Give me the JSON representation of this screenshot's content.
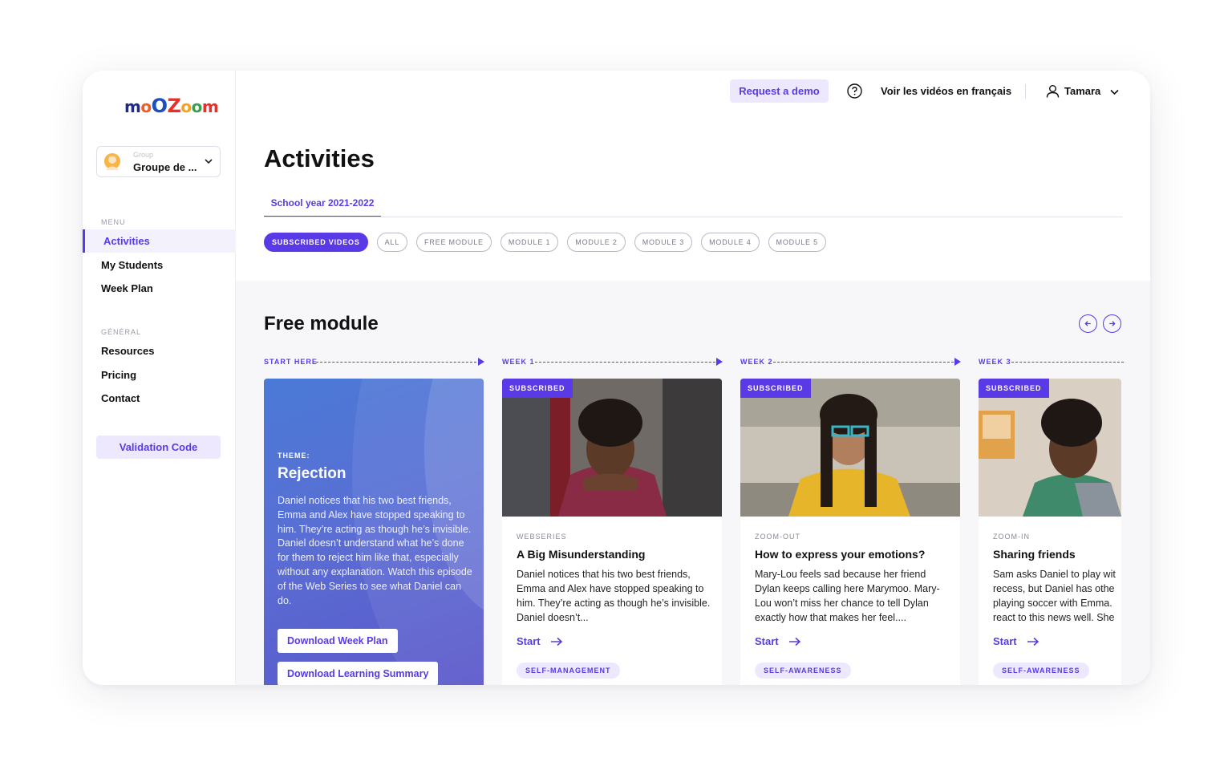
{
  "brand": {
    "logo_letters": [
      "m",
      "o",
      "O",
      "Z",
      "o",
      "o",
      "m"
    ],
    "logo_colors": [
      "#1e2a8c",
      "#f15a24",
      "#1e4fbf",
      "#e8302a",
      "#f7a21b",
      "#3aa04b",
      "#e8302a"
    ]
  },
  "sidebar": {
    "group": {
      "label": "Group",
      "name": "Groupe de ..."
    },
    "menu_label": "MENU",
    "menu_items": [
      {
        "label": "Activities",
        "active": true
      },
      {
        "label": "My Students",
        "active": false
      },
      {
        "label": "Week Plan",
        "active": false
      }
    ],
    "general_label": "GÉNÉRAL",
    "general_items": [
      {
        "label": "Resources"
      },
      {
        "label": "Pricing"
      },
      {
        "label": "Contact"
      }
    ],
    "validation_label": "Validation Code"
  },
  "topbar": {
    "demo_label": "Request a demo",
    "lang_label": "Voir les vidéos en français",
    "user_name": "Tamara"
  },
  "page": {
    "title": "Activities",
    "year_tab": "School year 2021-2022",
    "filters": [
      "SUBSCRIBED VIDEOS",
      "ALL",
      "FREE MODULE",
      "MODULE 1",
      "MODULE 2",
      "MODULE 3",
      "MODULE 4",
      "MODULE 5"
    ],
    "active_filter": "SUBSCRIBED VIDEOS"
  },
  "module": {
    "title": "Free module",
    "weeks": [
      "START HERE",
      "WEEK 1",
      "WEEK 2",
      "WEEK 3"
    ],
    "intro": {
      "theme_label": "THEME:",
      "theme_name": "Rejection",
      "description": "Daniel notices that his two best friends, Emma and Alex have stopped speaking to him. They’re acting as though he’s invisible. Daniel doesn’t understand what he’s done for them to reject him like that, especially without any explanation. Watch this episode of the Web Series to see what Daniel can do.",
      "week_plan_btn": "Download Week Plan",
      "summary_btn": "Download Learning Summary"
    },
    "videos": [
      {
        "badge": "SUBSCRIBED",
        "type": "WEBSERIES",
        "title": "A Big Misunderstanding",
        "description": "Daniel notices that his two best friends, Emma and Alex have stopped speaking to him. They’re acting as though he’s invisible. Daniel doesn’t...",
        "start": "Start",
        "tag": "SELF-MANAGEMENT"
      },
      {
        "badge": "SUBSCRIBED",
        "type": "ZOOM-OUT",
        "title": "How to express your emotions?",
        "description": "Mary-Lou feels sad because her friend Dylan keeps calling here Marymoo. Mary-Lou won’t miss her chance to tell Dylan exactly how that makes her feel....",
        "start": "Start",
        "tag": "SELF-AWARENESS"
      },
      {
        "badge": "SUBSCRIBED",
        "type": "ZOOM-IN",
        "title": "Sharing friends",
        "description": "Sam asks Daniel to play wit recess, but Daniel has othe playing soccer with Emma. react to this news well. She",
        "start": "Start",
        "tag": "SELF-AWARENESS"
      }
    ]
  },
  "colors": {
    "accent": "#5a3ae6",
    "accent_light": "#ede8fd"
  }
}
